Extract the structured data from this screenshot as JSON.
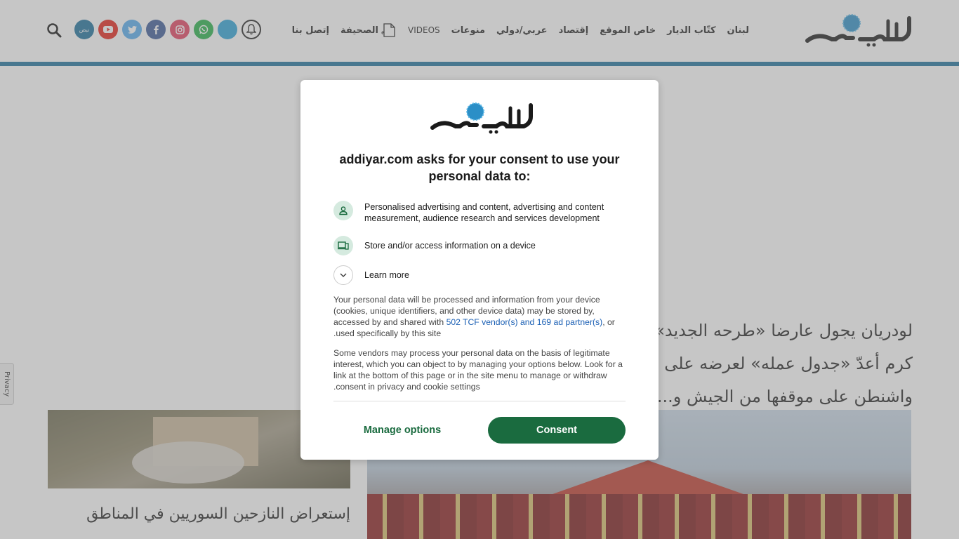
{
  "site": {
    "logo_text": "الديار"
  },
  "nav": {
    "items": [
      "لبنان",
      "كتّاب الديار",
      "خاص الموقع",
      "إقتصاد",
      "عربي/دولي",
      "منوعات",
      "VIDEOS",
      "الصحيفة",
      "إتصل بنا"
    ]
  },
  "social": {
    "icons": [
      "bell-icon",
      "telegram-icon",
      "whatsapp-icon",
      "instagram-icon",
      "facebook-icon",
      "twitter-icon",
      "youtube-icon",
      "nabd-icon"
    ],
    "nabd_label": "نبض",
    "colors": {
      "telegram": "#2aa3d8",
      "whatsapp": "#25b148",
      "instagram": "#e4405f",
      "facebook": "#3b5998",
      "twitter": "#55acee",
      "youtube": "#e62117",
      "nabd": "#1b6f9b"
    }
  },
  "article": {
    "headline_line1": "لودريان يجول عارضا «طرحه الجديد» ... قسم الاجتماع التفاوضي الثاني",
    "headline_line2": "كرم أعدّ «جدول عمله» لعرضه على ... ليزم سيناريو تنفيذ اتفاق وقف",
    "headline_line3": "واشنطن على موقفها من الجيش و...",
    "left_caption": "إستعراض النازحين السوريين في المناطق"
  },
  "privacy_tab": {
    "label": "Privacy"
  },
  "consent": {
    "title_line1": "addiyar.com asks for your consent to use your",
    "title_line2": ":personal data to",
    "purpose1": "Personalised advertising and content, advertising and content measurement, audience research and services development",
    "purpose2": "Store and/or access information on a device",
    "learn_more": "Learn more",
    "para1_a": "Your personal data will be processed and information from your device (cookies, unique identifiers, and other device data) may be stored by, accessed by and shared with ",
    "para1_link": "502 TCF vendor(s) and 169 ad partner(s)",
    "para1_b": ", or used specifically by this site.",
    "para2": "Some vendors may process your personal data on the basis of legitimate interest, which you can object to by managing your options below. Look for a link at the bottom of this page or in the site menu to manage or withdraw consent in privacy and cookie settings.",
    "manage_label": "Manage options",
    "consent_label": "Consent",
    "accent": "#1a6b3f",
    "icon_bg": "#d5eadf"
  }
}
